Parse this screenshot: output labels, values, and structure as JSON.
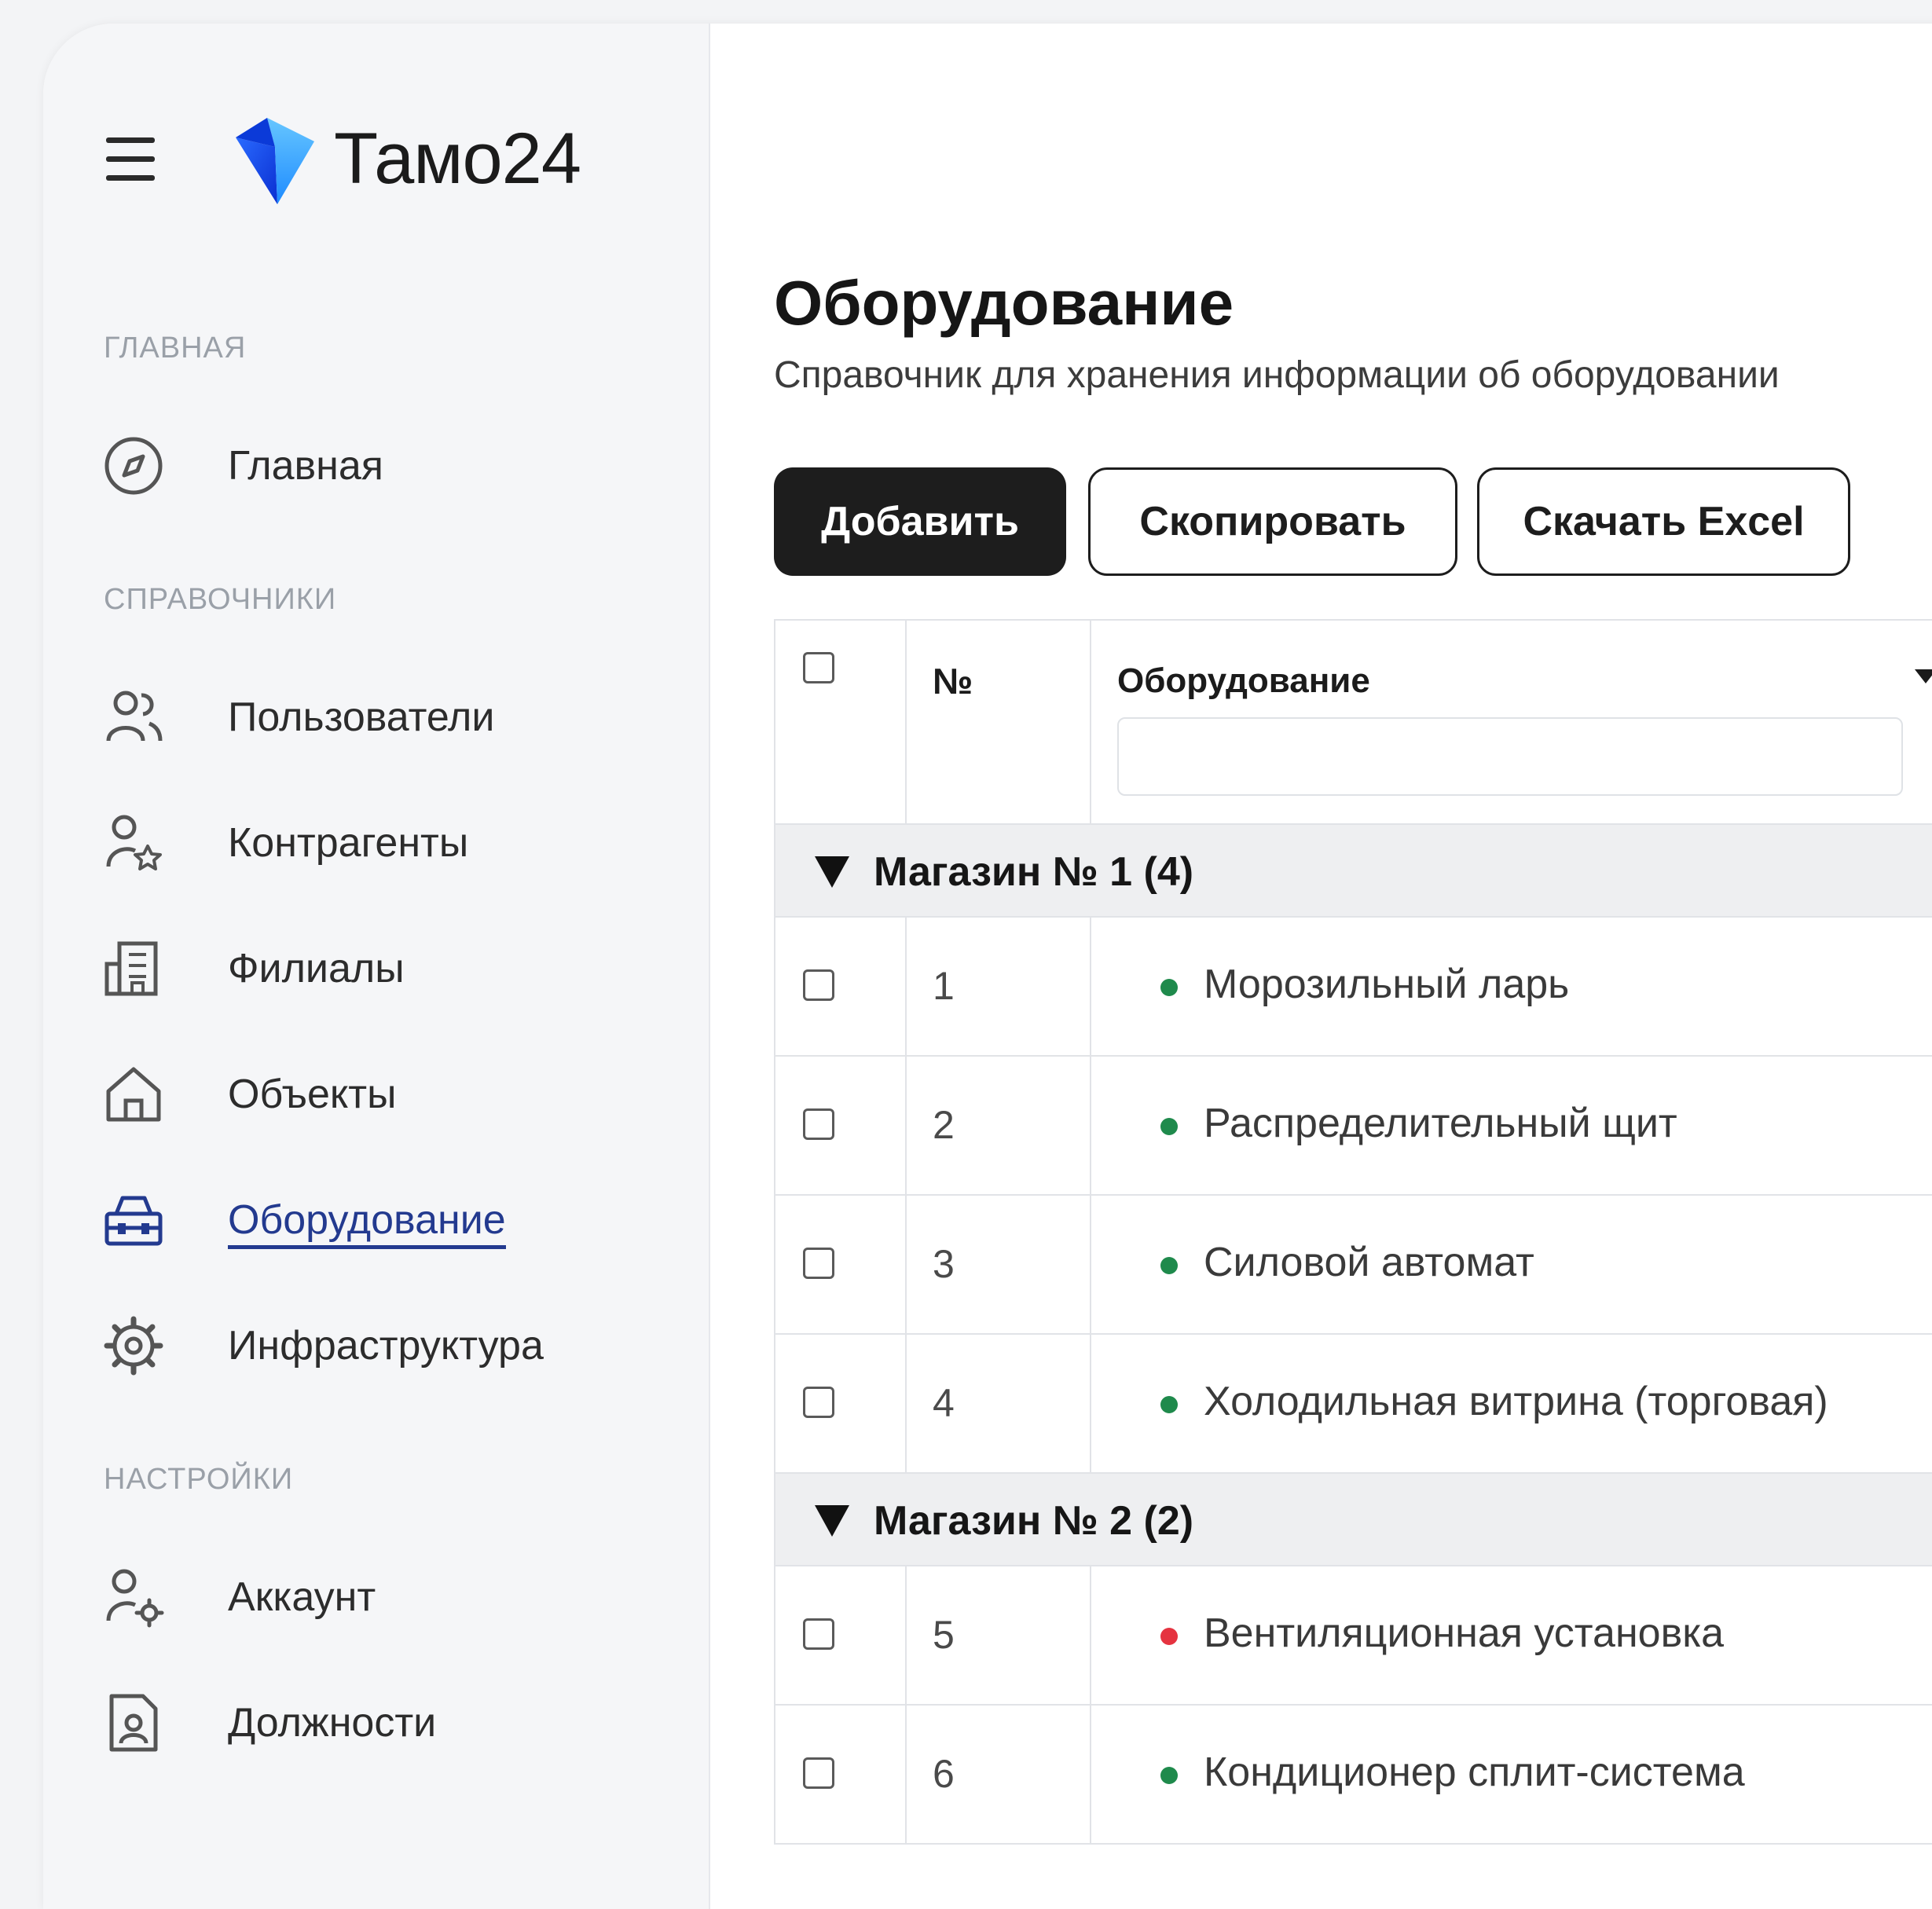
{
  "app": {
    "name": "Тамо24"
  },
  "sidebar": {
    "sections": [
      {
        "label": "ГЛАВНАЯ"
      },
      {
        "label": "СПРАВОЧНИКИ"
      },
      {
        "label": "НАСТРОЙКИ"
      }
    ],
    "items": [
      {
        "label": "Главная",
        "icon": "compass-icon"
      },
      {
        "label": "Пользователи",
        "icon": "users-icon"
      },
      {
        "label": "Контрагенты",
        "icon": "contractor-icon"
      },
      {
        "label": "Филиалы",
        "icon": "building-icon"
      },
      {
        "label": "Объекты",
        "icon": "home-icon"
      },
      {
        "label": "Оборудование",
        "icon": "toolbox-icon",
        "active": true
      },
      {
        "label": "Инфраструктура",
        "icon": "gear-icon"
      },
      {
        "label": "Аккаунт",
        "icon": "user-settings-icon"
      },
      {
        "label": "Должности",
        "icon": "badge-icon"
      }
    ]
  },
  "main": {
    "title": "Оборудование",
    "subtitle": "Справочник для хранения информации об оборудовании"
  },
  "toolbar": {
    "add_label": "Добавить",
    "copy_label": "Скопировать",
    "excel_label": "Скачать Excel"
  },
  "table": {
    "columns": {
      "num": "№",
      "equipment": "Оборудование"
    },
    "filter": {
      "placeholder": "",
      "value": ""
    },
    "groups": [
      {
        "title": "Магазин № 1 (4)",
        "rows": [
          {
            "num": "1",
            "name": "Морозильный ларь",
            "status_color": "#1f8a4c"
          },
          {
            "num": "2",
            "name": "Распределительный щит",
            "status_color": "#1f8a4c"
          },
          {
            "num": "3",
            "name": "Силовой автомат",
            "status_color": "#1f8a4c"
          },
          {
            "num": "4",
            "name": "Холодильная витрина (торговая)",
            "status_color": "#1f8a4c"
          }
        ]
      },
      {
        "title": "Магазин № 2 (2)",
        "rows": [
          {
            "num": "5",
            "name": "Вентиляционная установка",
            "status_color": "#e53340"
          },
          {
            "num": "6",
            "name": "Кондиционер сплит-система",
            "status_color": "#1f8a4c"
          }
        ]
      }
    ]
  },
  "colors": {
    "accent": "#233a8f",
    "logo_blue": "#1e5cff",
    "status_ok": "#1f8a4c",
    "status_error": "#e53340"
  }
}
